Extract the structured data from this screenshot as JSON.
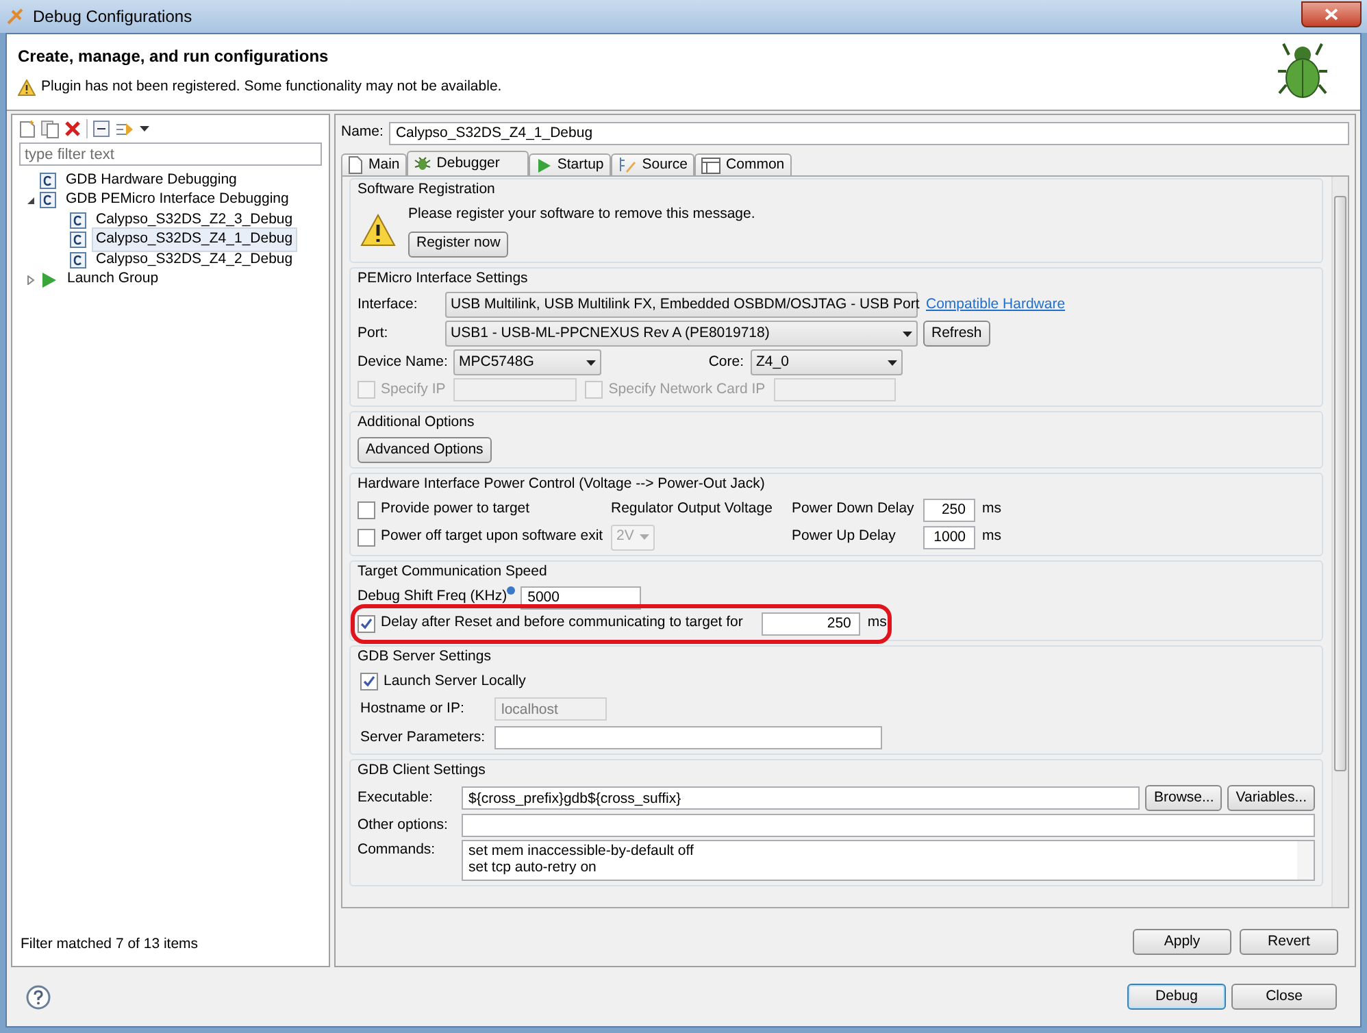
{
  "window": {
    "title": "Debug Configurations"
  },
  "header": {
    "title": "Create, manage, and run configurations",
    "warning": "Plugin has not been registered. Some functionality may not be available."
  },
  "filter": {
    "placeholder": "type filter text"
  },
  "tree": [
    {
      "label": "GDB Hardware Debugging",
      "kind": "type",
      "selected": false
    },
    {
      "label": "GDB PEMicro Interface Debugging",
      "kind": "type",
      "selected": false,
      "expanded": true,
      "children": [
        {
          "label": "Calypso_S32DS_Z2_3_Debug",
          "kind": "config",
          "selected": false
        },
        {
          "label": "Calypso_S32DS_Z4_1_Debug",
          "kind": "config",
          "selected": true
        },
        {
          "label": "Calypso_S32DS_Z4_2_Debug",
          "kind": "config",
          "selected": false
        }
      ]
    },
    {
      "label": "Launch Group",
      "kind": "group",
      "selected": false,
      "expanded": false
    }
  ],
  "filter_status": "Filter matched 7 of 13 items",
  "name": {
    "label": "Name:",
    "value": "Calypso_S32DS_Z4_1_Debug"
  },
  "tabs": [
    {
      "label": "Main",
      "kind": "main",
      "selected": false
    },
    {
      "label": "Debugger",
      "kind": "debugger",
      "selected": true
    },
    {
      "label": "Startup",
      "kind": "startup",
      "selected": false
    },
    {
      "label": "Source",
      "kind": "source",
      "selected": false
    },
    {
      "label": "Common",
      "kind": "common",
      "selected": false
    }
  ],
  "software_registration": {
    "title": "Software Registration",
    "message": "Please register your software to remove this message.",
    "button": "Register now"
  },
  "pemicro": {
    "title": "PEMicro Interface Settings",
    "interface": {
      "label": "Interface:",
      "value": "USB Multilink, USB Multilink FX, Embedded OSBDM/OSJTAG - USB Port",
      "disabled": false
    },
    "link": "Compatible Hardware",
    "port": {
      "label": "Port:",
      "value": "USB1 - USB-ML-PPCNEXUS Rev A (PE8019718)",
      "disabled": false
    },
    "refresh": "Refresh",
    "device": {
      "label": "Device Name:",
      "value": "MPC5748G",
      "disabled": false
    },
    "core": {
      "label": "Core:",
      "value": "Z4_0",
      "disabled": false
    },
    "specify_ip": {
      "label": "Specify IP",
      "checked": false,
      "disabled": true
    },
    "specify_card_ip": {
      "label": "Specify Network Card IP",
      "checked": false,
      "disabled": true
    }
  },
  "additional": {
    "title": "Additional Options",
    "button": "Advanced Options"
  },
  "power": {
    "title": "Hardware Interface Power Control (Voltage --> Power-Out Jack)",
    "provide": {
      "label": "Provide power to target",
      "checked": false,
      "disabled": false
    },
    "power_off": {
      "label": "Power off target upon software exit",
      "checked": false,
      "disabled": false
    },
    "regulator_label": "Regulator Output Voltage",
    "voltage": {
      "value": "2V",
      "disabled": true
    },
    "down": {
      "label": "Power Down Delay",
      "value": "250",
      "unit": "ms"
    },
    "up": {
      "label": "Power Up Delay",
      "value": "1000",
      "unit": "ms"
    }
  },
  "speed": {
    "title": "Target Communication Speed",
    "freq": {
      "label": "Debug Shift Freq (KHz)",
      "value": "5000"
    },
    "delay": {
      "label": "Delay after Reset and before communicating to target for",
      "checked": true,
      "disabled": false,
      "value": "250",
      "unit": "ms",
      "highlighted": true
    }
  },
  "server": {
    "title": "GDB Server Settings",
    "launch": {
      "label": "Launch Server Locally",
      "checked": true,
      "disabled": false
    },
    "host": {
      "label": "Hostname or IP:",
      "value": "localhost",
      "disabled": true
    },
    "params": {
      "label": "Server Parameters:"
    }
  },
  "client": {
    "title": "GDB Client Settings",
    "executable": {
      "label": "Executable:",
      "value": "${cross_prefix}gdb${cross_suffix}"
    },
    "browse": "Browse...",
    "variables": "Variables...",
    "other": {
      "label": "Other options:"
    },
    "commands": {
      "label": "Commands:",
      "lines": [
        "set mem inaccessible-by-default off",
        "set tcp auto-retry on"
      ]
    }
  },
  "buttons": {
    "apply": "Apply",
    "revert": "Revert",
    "debug": "Debug",
    "close": "Close"
  }
}
